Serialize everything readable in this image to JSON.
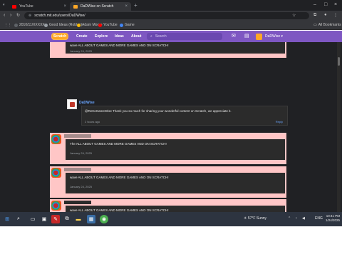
{
  "browser": {
    "tabs": [
      {
        "title": "YouTube",
        "favicon_color": "#ff0000"
      },
      {
        "title": "DaDWise on Scratch",
        "favicon_color": "#ffa726"
      }
    ],
    "url": "scratch.mit.edu/users/DaDWise/",
    "bookmarks": [
      {
        "label": "2010/11/XXXXX",
        "color": "#5f6368"
      },
      {
        "label": "Good Ideas (Roblox)",
        "color": "#9aa0a6"
      },
      {
        "label": "Adam Moore",
        "color": "#fbbc04"
      },
      {
        "label": "YouTube",
        "color": "#ff0000"
      },
      {
        "label": "Game",
        "color": "#4285f4"
      }
    ],
    "bookmarks_right": "All Bookmarks"
  },
  "site": {
    "logo": "Scratch",
    "nav": [
      "Create",
      "Explore",
      "Ideas",
      "About"
    ],
    "search_placeholder": "Search",
    "username": "DaDWise",
    "accent": "#7e57c2"
  },
  "comments": [
    {
      "text": "wave ALL ABOUT GAMES AND MORE GAMES AND ON SCRATCH!",
      "date": "January 24, 2025"
    },
    {
      "text": "The ALL ABOUT GAMES AND MORE GAMES AND ON SCRATCH!",
      "date": "January 24, 2025"
    },
    {
      "text": "wave ALL ABOUT GAMES AND MORE GAMES AND ON SCRATCH!",
      "date": "January 24, 2025"
    },
    {
      "text": "wave ALL ABOUT GAMES AND MORE GAMES AND ON SCRATCH!",
      "date": ""
    }
  ],
  "reply": {
    "author": "DaDWise",
    "text": "@RetroGameWise Thank you so much for sharing your wonderful content on Scratch, we appreciate it.",
    "date": "2 hours ago",
    "link": "Reply"
  },
  "taskbar": {
    "weather": "57°F Sunny",
    "lang": "ENG",
    "time": "10:41 PM",
    "date": "1/24/2025"
  }
}
